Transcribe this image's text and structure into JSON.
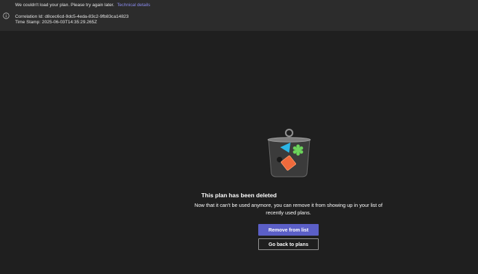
{
  "error_banner": {
    "message": "We couldn't load your plan. Please try again later.",
    "details_link": "Technical details",
    "correlation_id": "Correlation Id: d8cec6cd-9dc5-4eda-83c2-9fb83ca14823",
    "timestamp": "Time Stamp: 2025-06-03T14:35:29.265Z",
    "icon": "info-icon"
  },
  "empty_state": {
    "illustration": "trash-bin-icon",
    "title": "This plan has been deleted",
    "description": "Now that it can't be used anymore, you can remove it from showing up in your list of recently used plans."
  },
  "actions": {
    "remove_label": "Remove from list",
    "back_label": "Go back to plans"
  },
  "colors": {
    "background": "#1f1f1f",
    "banner": "#2c2c2c",
    "accent": "#5b5fc7",
    "link": "#8b8cf0"
  }
}
